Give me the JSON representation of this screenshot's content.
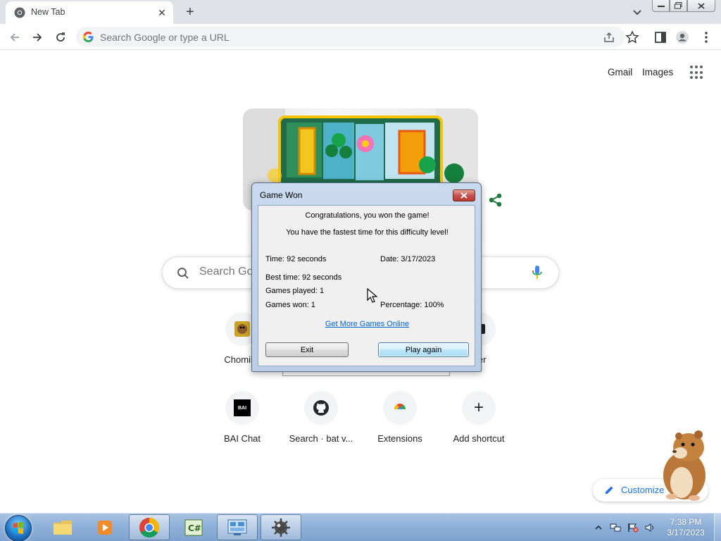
{
  "browser": {
    "tab_title": "New Tab",
    "omnibox_placeholder": "Search Google or type a URL"
  },
  "ntp": {
    "gmail_label": "Gmail",
    "images_label": "Images",
    "search_placeholder": "Search Go",
    "customize_label": "Customize",
    "shortcuts": [
      {
        "label": "Chomiku",
        "icon": "chomikuj-icon"
      },
      {
        "label": "iver",
        "icon": "driver-icon"
      },
      {
        "label": "BAI Chat",
        "icon": "bai-chat-icon",
        "icon_text": "BAI"
      },
      {
        "label": "Search · bat v...",
        "icon": "github-icon"
      },
      {
        "label": "Extensions",
        "icon": "chrome-web-store-icon"
      },
      {
        "label": "Add shortcut",
        "icon": "plus-icon",
        "icon_text": "+"
      }
    ]
  },
  "dialog": {
    "title": "Game Won",
    "congrats": "Congratulations, you won the game!",
    "fastest": "You have the fastest time for this difficulty level!",
    "time": "Time: 92 seconds",
    "date": "Date: 3/17/2023",
    "best_time": "Best time: 92 seconds",
    "games_played": "Games played: 1",
    "games_won": "Games won: 1",
    "percentage": "Percentage: 100%",
    "link": "Get More Games Online",
    "exit_label": "Exit",
    "play_again_label": "Play again"
  },
  "taskbar": {
    "clock_time": "7:38 PM",
    "clock_date": "3/17/2023",
    "items": [
      "windows-explorer-icon",
      "media-player-icon",
      "chrome-icon",
      "csharp-icon",
      "control-panel-icon",
      "minesweeper-icon"
    ]
  },
  "colors": {
    "link_blue": "#1a73e8",
    "dialog_link": "#0066cc",
    "taskbar": "#8fb0d8"
  }
}
